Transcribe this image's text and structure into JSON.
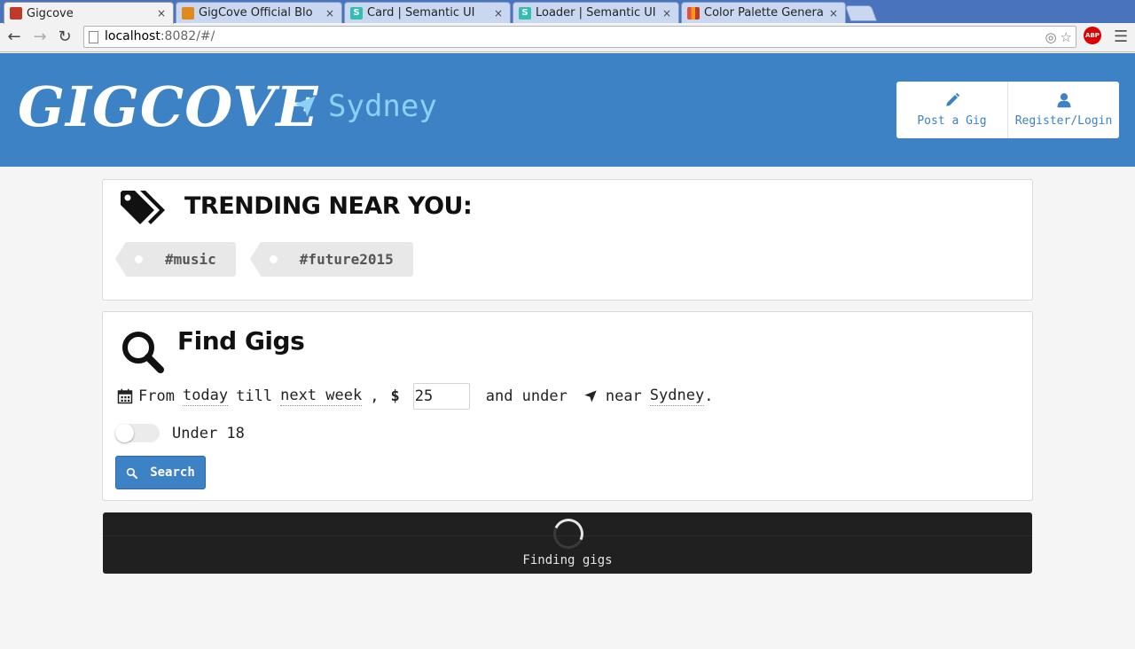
{
  "browser": {
    "tabs": [
      {
        "title": "Gigcove",
        "favicon": "gigcove-favicon",
        "active": true
      },
      {
        "title": "GigCove Official Blo",
        "favicon": "blog-favicon",
        "active": false
      },
      {
        "title": "Card | Semantic UI",
        "favicon": "semantic-ui-favicon",
        "active": false
      },
      {
        "title": "Loader | Semantic UI",
        "favicon": "semantic-ui-favicon",
        "active": false
      },
      {
        "title": "Color Palette Genera",
        "favicon": "palette-favicon",
        "active": false
      }
    ],
    "tab_close": "×",
    "url_host": "localhost",
    "url_rest": ":8082/#/",
    "abp_label": "ABP"
  },
  "header": {
    "brand": "GIGCOVE",
    "location": "Sydney",
    "post_gig_label": "Post a Gig",
    "register_label": "Register/Login",
    "background_color": "#3d82c4",
    "location_color": "#8dd0f5"
  },
  "trending": {
    "title": "Trending near you:",
    "tags": [
      "#music",
      "#future2015"
    ]
  },
  "find": {
    "title": "Find Gigs",
    "from_label": "From",
    "from_value": "today",
    "till_label": "till",
    "till_value": "next week",
    "comma": ",",
    "dollar": "$",
    "price_value": "25",
    "and_under": "and under",
    "near_label": "near",
    "near_value": "Sydney",
    "period": ".",
    "under18_label": "Under 18",
    "under18_on": false,
    "search_label": "Search"
  },
  "loader": {
    "text": "Finding gigs"
  }
}
